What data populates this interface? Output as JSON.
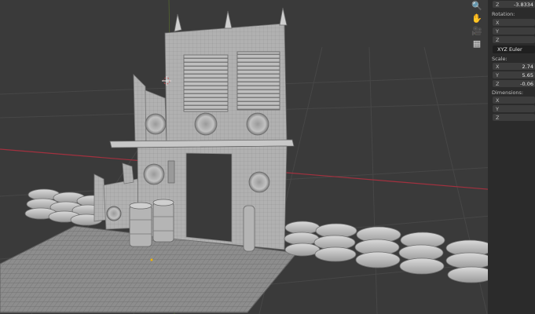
{
  "transform_panel": {
    "location": {
      "z": {
        "axis": "Z",
        "value": "-3.8334"
      }
    },
    "rotation": {
      "label": "Rotation:",
      "x": {
        "axis": "X",
        "value": ""
      },
      "y": {
        "axis": "Y",
        "value": ""
      },
      "z": {
        "axis": "Z",
        "value": ""
      },
      "mode": "XYZ Euler"
    },
    "scale": {
      "label": "Scale:",
      "x": {
        "axis": "X",
        "value": "2.74"
      },
      "y": {
        "axis": "Y",
        "value": "5.65"
      },
      "z": {
        "axis": "Z",
        "value": "-0.06"
      }
    },
    "dimensions": {
      "label": "Dimensions:",
      "x": {
        "axis": "X",
        "value": ""
      },
      "y": {
        "axis": "Y",
        "value": ""
      },
      "z": {
        "axis": "Z",
        "value": ""
      }
    }
  },
  "navigation": {
    "icons": [
      "zoom-icon",
      "pan-hand-icon",
      "camera-icon",
      "grid-view-icon"
    ]
  },
  "colors": {
    "viewport_bg": "#3a3a3a",
    "grid_line": "#474747",
    "x_axis": "#a2313f",
    "y_axis": "#6c8f27",
    "model": "#a9a9a9",
    "panel_bg": "#2b2b2b"
  }
}
